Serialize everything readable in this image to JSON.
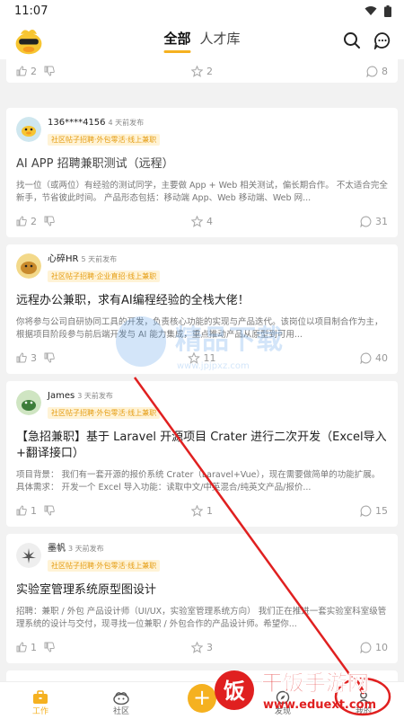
{
  "status_bar": {
    "time": "11:07"
  },
  "header": {
    "tabs": [
      {
        "label": "全部"
      },
      {
        "label": "人才库"
      }
    ]
  },
  "top_partial": {
    "likes": "2",
    "favorites": "2",
    "comments": "8"
  },
  "posts": [
    {
      "author": "136****4156",
      "posted": "4 天前发布",
      "tag": "社区帖子招聘·外包零活·线上兼职",
      "title": "AI APP 招聘兼职测试（远程）",
      "excerpt": "找一位（或两位）有经验的测试同学，主要做 App + Web 相关测试，偏长期合作。 不太适合完全新手，节省彼此时间。 产品形态包括：移动端 App、Web 移动端、Web 网...",
      "likes": "2",
      "favorites": "4",
      "comments": "31"
    },
    {
      "author": "心碎HR",
      "posted": "5 天前发布",
      "tag": "社区帖子招聘·企业直招·线上兼职",
      "title": "远程办公兼职，求有AI编程经验的全栈大佬！",
      "excerpt": "你将参与公司自研协同工具的开发，负责核心功能的实现与产品迭代。该岗位以项目制合作为主，根据项目阶段参与前后端开发与 AI 能力集成，重点推动产品从原型到可用...",
      "likes": "3",
      "favorites": "11",
      "comments": "40"
    },
    {
      "author": "James",
      "posted": "3 天前发布",
      "tag": "社区帖子招聘·外包零活·线上兼职",
      "title": "【急招兼职】基于 Laravel 开源项目 Crater 进行二次开发（Excel导入+翻译接口）",
      "excerpt": "项目背景： 我们有一套开源的报价系统 Crater（Laravel+Vue），现在需要做简单的功能扩展。 具体需求： 开发一个 Excel 导入功能：读取中文/中英混合/纯英文产品/报价...",
      "likes": "1",
      "favorites": "1",
      "comments": "15"
    },
    {
      "author": "墨帆",
      "posted": "3 天前发布",
      "tag": "社区帖子招聘·外包零活·线上兼职",
      "title": "实验室管理系统原型图设计",
      "excerpt": "招聘：兼职 / 外包 产品设计师（UI/UX，实验室管理系统方向） 我们正在推进一套实验室科室级管理系统的设计与交付，现寻找一位兼职 / 外包合作的产品设计师。希望你...",
      "likes": "1",
      "favorites": "3",
      "comments": "10"
    }
  ],
  "bottom_nav": [
    {
      "label": "工作"
    },
    {
      "label": "社区"
    },
    {
      "label": "发现"
    },
    {
      "label": "我的"
    }
  ],
  "watermarks": {
    "center_text": "精品下载",
    "center_url": "www.jpjpxz.com",
    "corner_text": "干饭手游网",
    "corner_url": "www.eduext.com",
    "corner_badge": "饭"
  },
  "colors": {
    "accent": "#f5b120",
    "tag_bg": "#fff3d6",
    "tag_text": "#e59d13",
    "annotation_red": "#e02020"
  }
}
